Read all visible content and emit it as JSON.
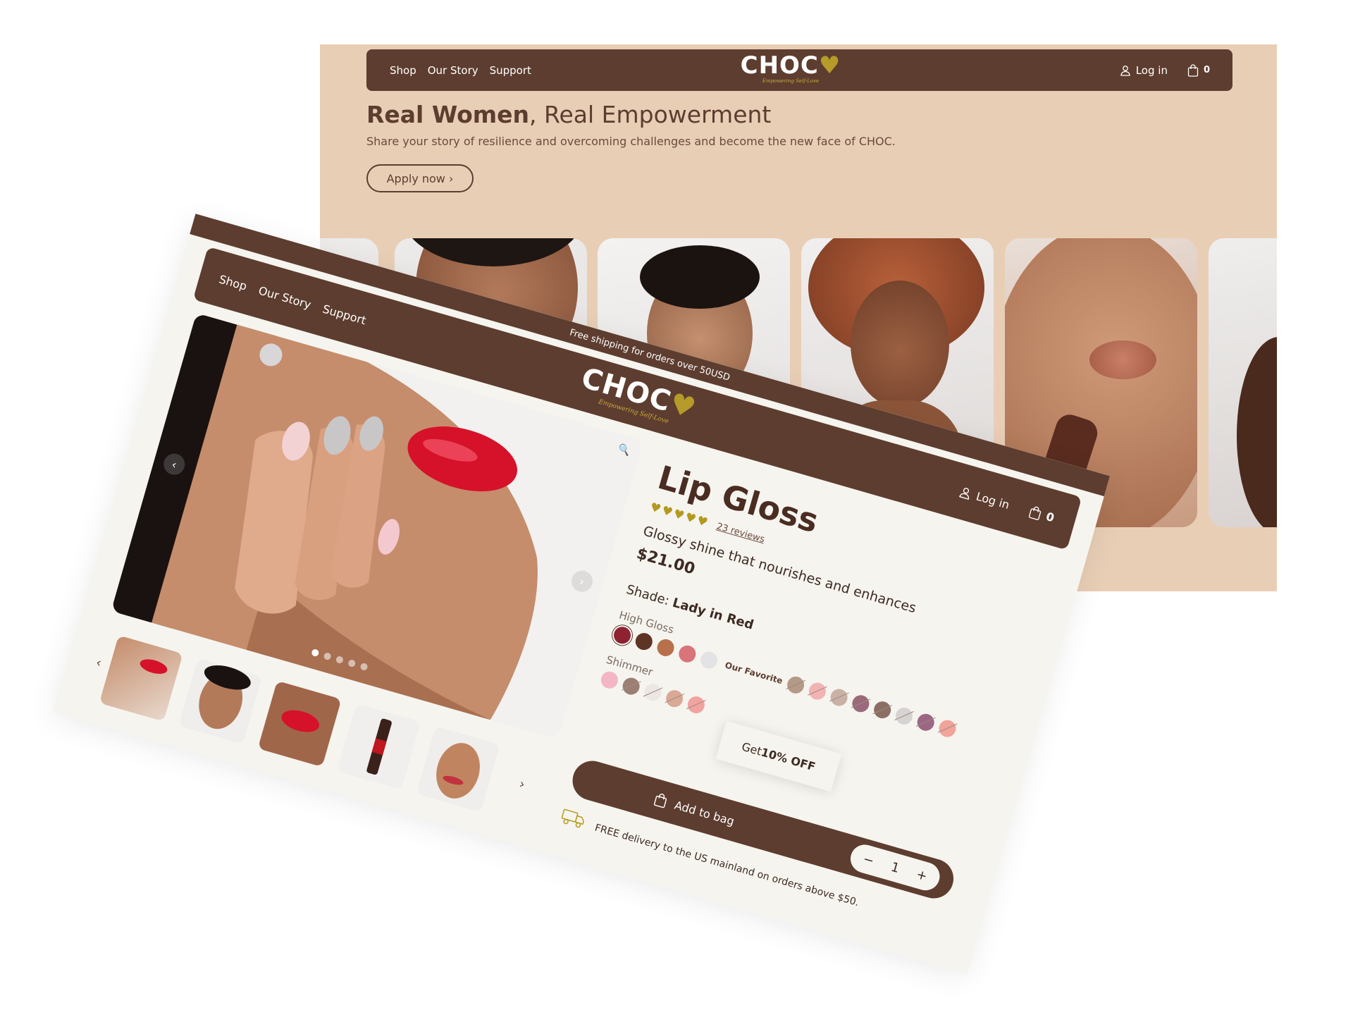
{
  "landing": {
    "nav": {
      "links": [
        "Shop",
        "Our Story",
        "Support"
      ],
      "logo": "CHOC",
      "logo_tagline": "Empowering Self-Love",
      "login": "Log in",
      "cart_count": "0"
    },
    "hero": {
      "title_bold": "Real Women",
      "title_rest": ", Real Empowerment",
      "subtitle": "Share your story of resilience and overcoming challenges and become the new face of CHOC.",
      "cta": "Apply now ›"
    }
  },
  "product_page": {
    "promo": "Free shipping for orders over 50USD",
    "nav": {
      "links": [
        "Shop",
        "Our Story",
        "Support"
      ],
      "logo": "CHOC",
      "logo_tagline": "Empowering Self-Love",
      "login": "Log in",
      "cart_count": "0"
    },
    "product": {
      "title": "Lip Gloss",
      "rating": 5,
      "reviews": "23 reviews",
      "tagline": "Glossy shine that nourishes and enhances",
      "price": "$21.00",
      "shade_label": "Shade:",
      "shade_value": "Lady in Red",
      "high_gloss_label": "High Gloss",
      "shimmer_label": "Shimmer",
      "favorite_label": "Our Favorite",
      "high_gloss_swatches": [
        "#8e2232",
        "#5e3424",
        "#b8704a",
        "#d9747a",
        "#e3e3e6",
        "#b59a88",
        "#f1b3b3",
        "#c9b1a6",
        "#9a6a7c",
        "#8c6f64",
        "#d8d3d3",
        "#9c6784",
        "#f0a49a"
      ],
      "shimmer_swatches": [
        "#f3b6c4",
        "#9b7f74",
        "#ece7e4",
        "#d9a996",
        "#f2a3a0"
      ],
      "selected_shade_index": 0,
      "add_to_bag": "Add to bag",
      "quantity": "1",
      "qty_minus": "−",
      "qty_plus": "+",
      "delivery_note": "FREE delivery to the US mainland on orders above $50."
    },
    "gallery": {
      "slide_count": 5,
      "active_slide": 0,
      "prev_icon": "‹",
      "next_icon": "›",
      "thumbs_count": 5
    },
    "discount_tab": {
      "prefix": "Get ",
      "bold": "10% OFF"
    }
  },
  "colors": {
    "brand_brown": "#5d3d2f",
    "cream": "#f6f4ee",
    "peach": "#e9ceb6",
    "gold": "#b39a1f"
  }
}
